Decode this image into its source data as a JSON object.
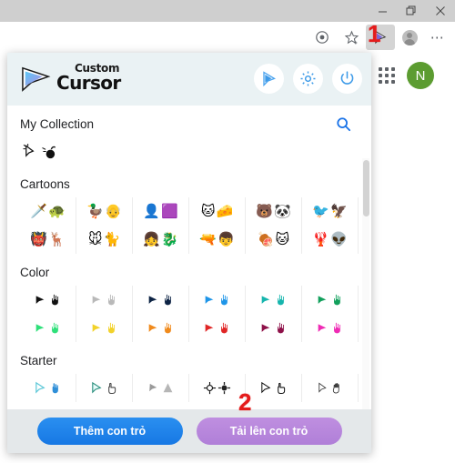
{
  "window": {
    "controls": [
      {
        "name": "minimize",
        "glyph": "–"
      },
      {
        "name": "restore",
        "glyph": "❐"
      },
      {
        "name": "close",
        "glyph": "✕"
      }
    ]
  },
  "browser_toolbar": {
    "icons": [
      {
        "name": "cast-icon",
        "title": "Cast"
      },
      {
        "name": "bookmark-star-icon",
        "title": "Add to favorites"
      },
      {
        "name": "custom-cursor-extension-icon",
        "title": "Custom Cursor",
        "active": true
      },
      {
        "name": "profile-avatar-icon",
        "title": "Profile"
      },
      {
        "name": "browser-menu-icon",
        "title": "Settings and more"
      }
    ]
  },
  "annotations": [
    {
      "id": "1",
      "label": "1",
      "color": "#e41b1b"
    },
    {
      "id": "2",
      "label": "2",
      "color": "#e41b1b"
    }
  ],
  "page_behind": {
    "apps_grid_label": "Google apps",
    "account_initial": "N",
    "account_color": "#5c9c31"
  },
  "popup": {
    "logo": {
      "line1": "Custom",
      "line2": "Cursor"
    },
    "header_buttons": [
      {
        "name": "cursor-icon-button",
        "icon": "cursor-arrow"
      },
      {
        "name": "settings-gear-button",
        "icon": "gear"
      },
      {
        "name": "power-toggle-button",
        "icon": "power"
      }
    ],
    "search": {
      "name": "search-icon",
      "label": "Search"
    },
    "sections": [
      {
        "title": "My Collection",
        "rows": [
          [
            {
              "cells": [
                "✨➤",
                "💣"
              ]
            }
          ]
        ]
      },
      {
        "title": "Cartoons",
        "rows": [
          [
            [
              "🗡️",
              "🐢"
            ],
            [
              "🦆",
              "👴"
            ],
            [
              "👤",
              "🟪"
            ],
            [
              "🐱",
              "🧀"
            ],
            [
              "🐻",
              "🐼"
            ],
            [
              "🐦",
              "🦅"
            ]
          ],
          [
            [
              "👹",
              "🦌"
            ],
            [
              "🐭",
              "🐈"
            ],
            [
              "👧",
              "🐉"
            ],
            [
              "🔫",
              "👦"
            ],
            [
              "🍖",
              "🐱"
            ],
            [
              "🦞",
              "👽"
            ]
          ]
        ]
      },
      {
        "title": "Color",
        "rows": [
          [
            "#111111",
            "#b9b9b9",
            "#0d2344",
            "#1e95e8",
            "#16b5ad",
            "#12a05c"
          ],
          [
            "#2fe07a",
            "#f2d22a",
            "#f08a1c",
            "#e02626",
            "#8e1149",
            "#ef2bb4"
          ]
        ]
      },
      {
        "title": "Starter",
        "rows": [
          [
            "#5ec8d8",
            "#2f8fd8",
            "#2a8f7d",
            "#444444",
            "#9a9a9a",
            "#b6b6b6",
            "#111111",
            "#222222"
          ]
        ]
      }
    ],
    "footer": {
      "add_cursor_label": "Thêm con trỏ",
      "upload_cursor_label": "Tải lên con trỏ",
      "add_color": "#1778e4",
      "upload_color": "#b07fd8"
    }
  }
}
